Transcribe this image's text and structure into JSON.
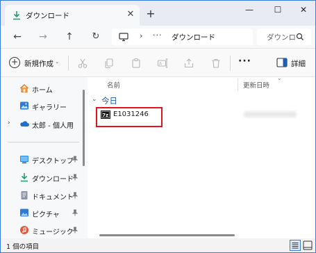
{
  "tab": {
    "title": "ダウンロード",
    "close_glyph": "✕",
    "new_tab_glyph": "+"
  },
  "window": {
    "minimize_glyph": "—",
    "maximize_glyph": "☐",
    "close_glyph": "✕"
  },
  "nav": {
    "back_glyph": "←",
    "forward_glyph": "→",
    "up_glyph": "↑",
    "refresh_glyph": "↻"
  },
  "address": {
    "chevron": "›",
    "more": "···",
    "path": "ダウンロード"
  },
  "search": {
    "placeholder": "ダウンロ"
  },
  "toolbar": {
    "new_label": "新規作成",
    "new_chevron": "⌄",
    "more_glyph": "···",
    "details_label": "詳細"
  },
  "sidebar": {
    "items": [
      {
        "label": "ホーム",
        "icon": "home-icon"
      },
      {
        "label": "ギャラリー",
        "icon": "gallery-icon"
      },
      {
        "label": "太郎 - 個人用",
        "icon": "onedrive-icon",
        "chevron": "›"
      },
      {
        "label": "デスクトップ",
        "icon": "desktop-icon",
        "pinned": true
      },
      {
        "label": "ダウンロード",
        "icon": "download-icon",
        "pinned": true
      },
      {
        "label": "ドキュメント",
        "icon": "documents-icon",
        "pinned": true
      },
      {
        "label": "ピクチャ",
        "icon": "pictures-icon",
        "pinned": true
      },
      {
        "label": "ミュージック",
        "icon": "music-icon",
        "pinned": true
      }
    ]
  },
  "columns": {
    "name": "名前",
    "date": "更新日時",
    "sort_glyph": "⌄"
  },
  "group": {
    "label": "今日",
    "chevron": "⌄"
  },
  "files": [
    {
      "name": "E1031246",
      "icon": "archive-7z-icon"
    }
  ],
  "status": {
    "count_text": "1 個の項目"
  },
  "colors": {
    "accent": "#1f5fae",
    "highlight_border": "#e0141c",
    "window_border": "#3a7bd5"
  }
}
